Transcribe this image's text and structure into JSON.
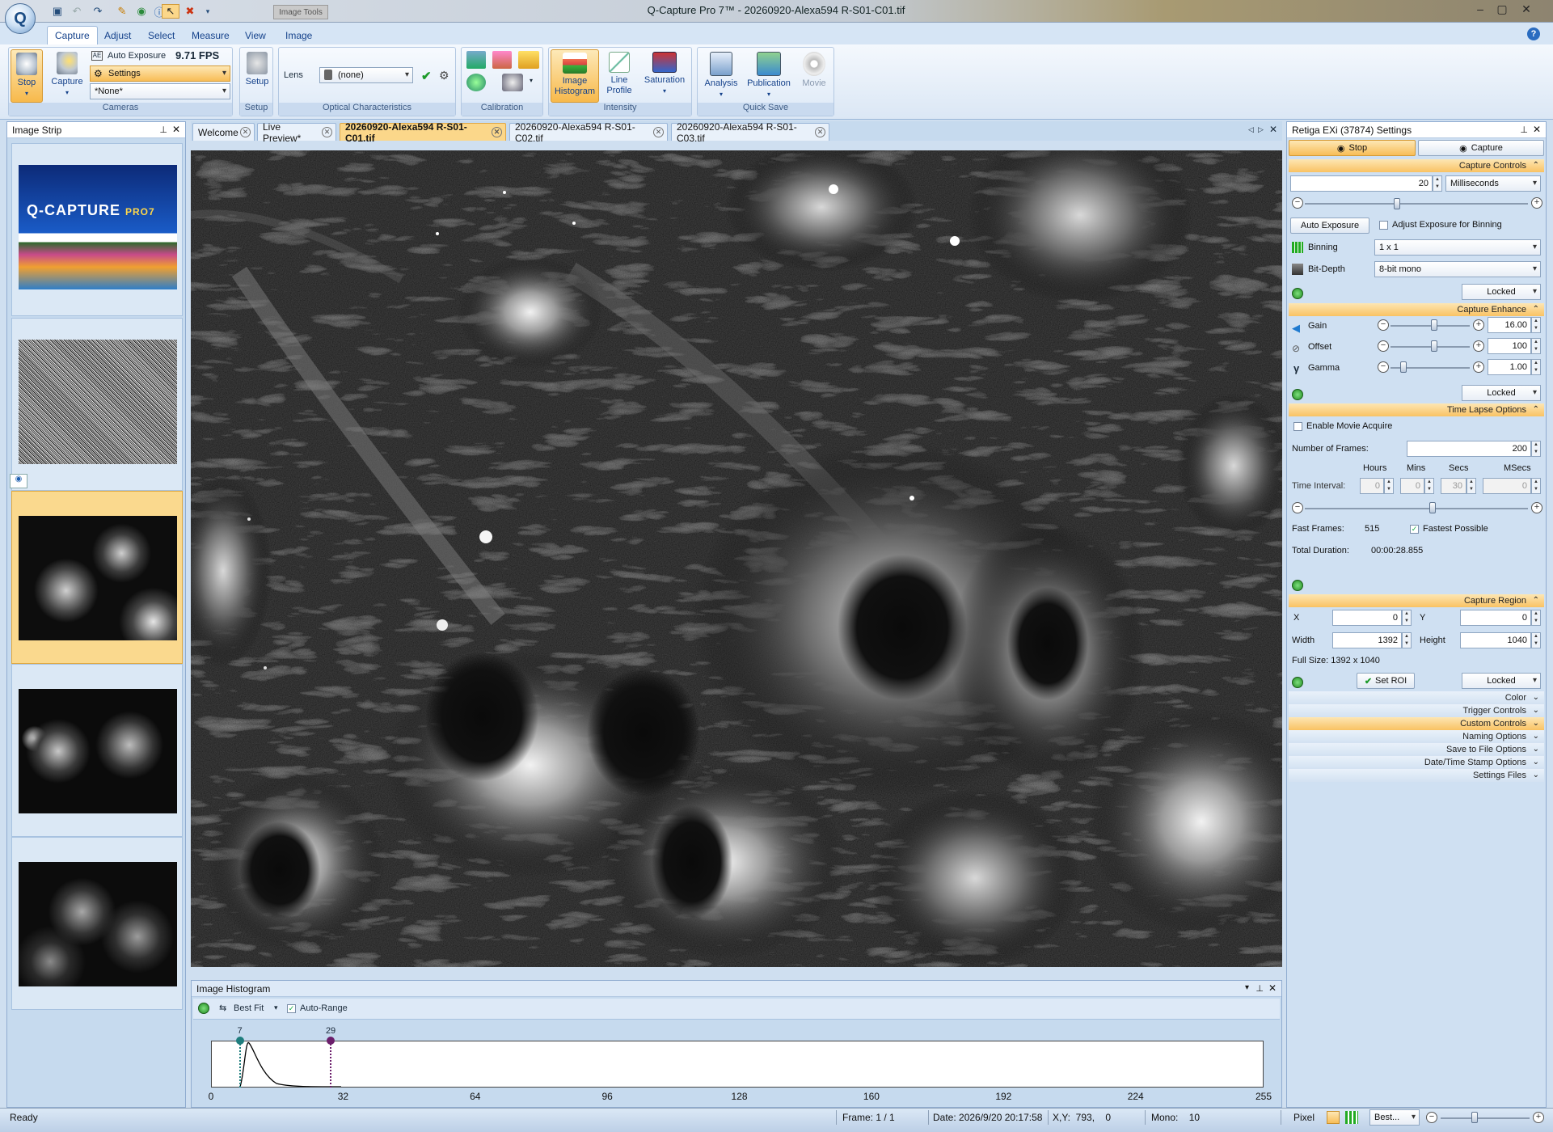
{
  "window": {
    "title": "Q-Capture Pro 7™ - 20260920-Alexa594 R-S01-C01.tif",
    "context_tab": "Image Tools"
  },
  "ribbon": {
    "tabs": [
      "Capture",
      "Adjust",
      "Select",
      "Measure",
      "View",
      "Image"
    ],
    "active_tab": "Capture",
    "cameras": {
      "stop": "Stop",
      "capture": "Capture",
      "auto_exposure": "Auto Exposure",
      "fps": "9.71 FPS",
      "settings": "Settings",
      "preset": "*None*",
      "label": "Cameras"
    },
    "setup": {
      "button": "Setup",
      "label": "Setup"
    },
    "optical": {
      "lens": "Lens",
      "lens_value": "(none)",
      "label": "Optical Characteristics"
    },
    "calibration": {
      "label": "Calibration"
    },
    "intensity": {
      "image_histogram_1": "Image",
      "image_histogram_2": "Histogram",
      "line_profile_1": "Line",
      "line_profile_2": "Profile",
      "saturation": "Saturation",
      "label": "Intensity"
    },
    "quick_save": {
      "analysis": "Analysis",
      "publication": "Publication",
      "movie": "Movie",
      "label": "Quick Save"
    }
  },
  "image_strip": {
    "title": "Image Strip",
    "splash_brand": "Q-CAPTURE",
    "splash_pro": "PRO7"
  },
  "doc_tabs": [
    "Welcome",
    "Live Preview*",
    "20260920-Alexa594 R-S01-C01.tif",
    "20260920-Alexa594 R-S01-C02.tif",
    "20260920-Alexa594 R-S01-C03.tif"
  ],
  "active_doc_tab": 2,
  "histogram": {
    "title": "Image Histogram",
    "best_fit": "Best Fit",
    "auto_range": "Auto-Range",
    "low_marker": "7",
    "high_marker": "29",
    "x_ticks": [
      "0",
      "32",
      "64",
      "96",
      "128",
      "160",
      "192",
      "224",
      "255"
    ],
    "low_value": 7,
    "high_value": 29,
    "x_max": 255
  },
  "settings": {
    "title": "Retiga EXi (37874) Settings",
    "stop": "Stop",
    "capture": "Capture",
    "capture_controls": {
      "header": "Capture Controls",
      "exposure_value": "20",
      "exposure_unit": "Milliseconds",
      "auto_exposure": "Auto Exposure",
      "adjust_binning": "Adjust Exposure for Binning",
      "binning_label": "Binning",
      "binning_value": "1 x 1",
      "bitdepth_label": "Bit-Depth",
      "bitdepth_value": "8-bit mono",
      "locked": "Locked"
    },
    "capture_enhance": {
      "header": "Capture Enhance",
      "gain_label": "Gain",
      "gain_value": "16.00",
      "offset_label": "Offset",
      "offset_value": "100",
      "gamma_label": "Gamma",
      "gamma_value": "1.00",
      "locked": "Locked"
    },
    "time_lapse": {
      "header": "Time Lapse Options",
      "enable_movie": "Enable Movie Acquire",
      "frames_label": "Number of Frames:",
      "frames_value": "200",
      "hours": "Hours",
      "mins": "Mins",
      "secs": "Secs",
      "msecs": "MSecs",
      "interval_label": "Time Interval:",
      "hours_value": "0",
      "mins_value": "0",
      "secs_value": "30",
      "msecs_value": "0",
      "fast_frames_label": "Fast Frames:",
      "fast_frames_value": "515",
      "fastest_possible": "Fastest Possible",
      "total_duration_label": "Total Duration:",
      "total_duration_value": "00:00:28.855"
    },
    "capture_region": {
      "header": "Capture Region",
      "x_label": "X",
      "x_value": "0",
      "y_label": "Y",
      "y_value": "0",
      "width_label": "Width",
      "width_value": "1392",
      "height_label": "Height",
      "height_value": "1040",
      "full_size": "Full Size: 1392 x 1040",
      "set_roi": "Set ROI",
      "locked": "Locked"
    },
    "collapsed_sections": [
      "Color",
      "Trigger Controls",
      "Custom Controls",
      "Naming Options",
      "Save to File Options",
      "Date/Time Stamp Options",
      "Settings Files"
    ]
  },
  "status": {
    "ready": "Ready",
    "frame": "Frame: 1 / 1",
    "date": "Date: 2026/9/20 20:17:58",
    "xy": "X,Y:  793,    0",
    "mono": "Mono:    10",
    "pixel": "Pixel",
    "zoom_mode": "Best..."
  },
  "colors": {
    "accent": "#f9c263",
    "ribbon": "#dbe7f5",
    "panel": "#cfe0f2",
    "low_marker": "#1e7d7d",
    "high_marker": "#6b1e6b"
  }
}
